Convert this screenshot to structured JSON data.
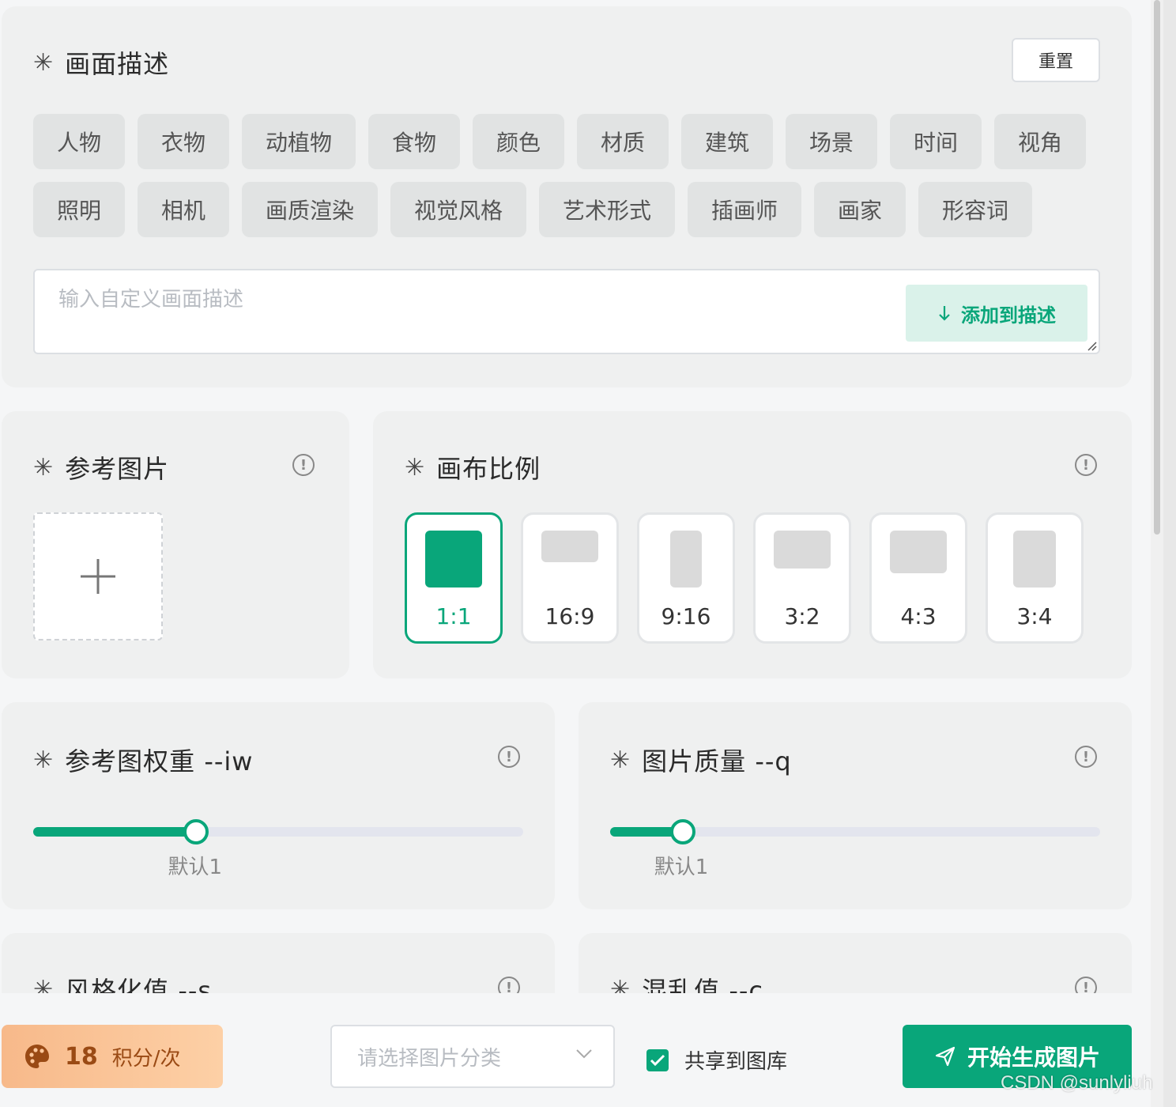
{
  "description": {
    "title": "画面描述",
    "reset_label": "重置",
    "tags_row1": [
      "人物",
      "衣物",
      "动植物",
      "食物",
      "颜色",
      "材质",
      "建筑",
      "场景",
      "时间",
      "视角"
    ],
    "tags_row2": [
      "照明",
      "相机",
      "画质渲染",
      "视觉风格",
      "艺术形式",
      "插画师",
      "画家",
      "形容词"
    ],
    "input_placeholder": "输入自定义画面描述",
    "add_label": "添加到描述"
  },
  "reference": {
    "title": "参考图片"
  },
  "canvas": {
    "title": "画布比例",
    "ratios": [
      {
        "label": "1:1",
        "selected": true
      },
      {
        "label": "16:9",
        "selected": false
      },
      {
        "label": "9:16",
        "selected": false
      },
      {
        "label": "3:2",
        "selected": false
      },
      {
        "label": "4:3",
        "selected": false
      },
      {
        "label": "3:4",
        "selected": false
      }
    ]
  },
  "iw": {
    "title": "参考图权重 --iw",
    "default_label": "默认1",
    "fraction": 0.333
  },
  "quality": {
    "title": "图片质量 --q",
    "default_label": "默认1",
    "fraction": 0.148
  },
  "stylize": {
    "title": "风格化值 --s"
  },
  "chaos": {
    "title": "混乱值 --c"
  },
  "bottom": {
    "credits_value": "18",
    "credits_unit": "积分/次",
    "category_placeholder": "请选择图片分类",
    "share_label": "共享到图库",
    "generate_label": "开始生成图片"
  },
  "watermark": "CSDN @sunlyliuh",
  "colors": {
    "accent": "#09a67a",
    "accent_light": "#daf2ea",
    "card_bg": "#eff0f0"
  }
}
